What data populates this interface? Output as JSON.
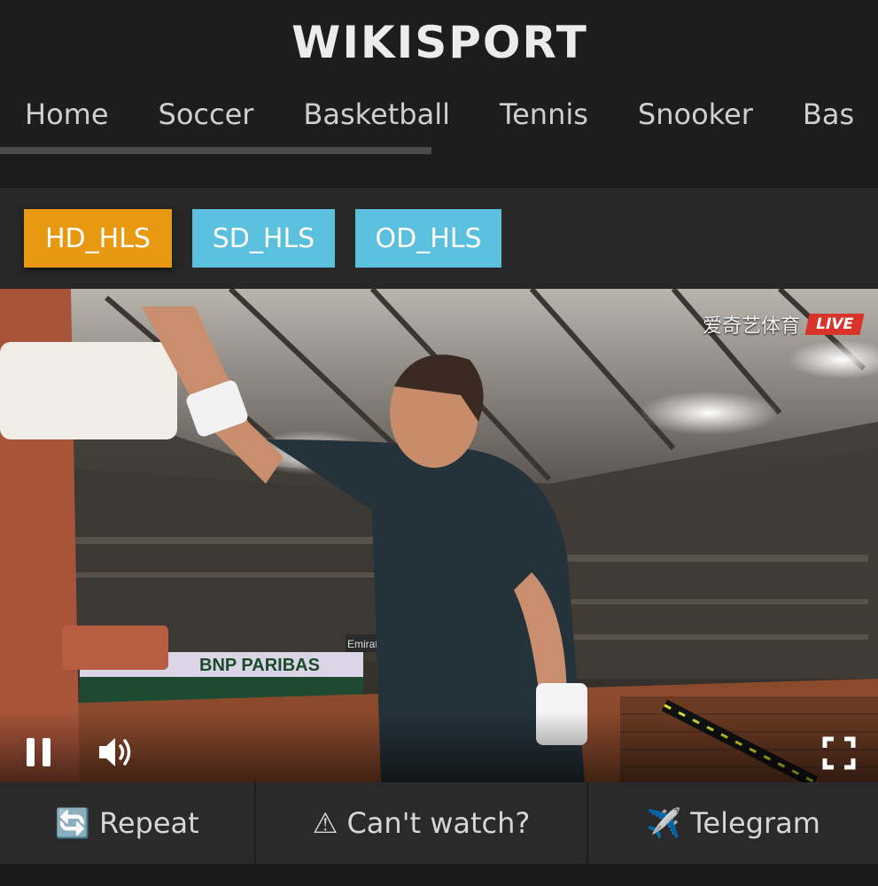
{
  "header": {
    "logo": "WIKISPORT"
  },
  "nav": {
    "items": [
      {
        "label": "Home"
      },
      {
        "label": "Soccer"
      },
      {
        "label": "Basketball"
      },
      {
        "label": "Tennis"
      },
      {
        "label": "Snooker"
      },
      {
        "label": "Bas"
      }
    ]
  },
  "sources": [
    {
      "label": "HD_HLS",
      "active": true,
      "color": "#e8990f"
    },
    {
      "label": "SD_HLS",
      "active": false,
      "color": "#5ac0de"
    },
    {
      "label": "OD_HLS",
      "active": false,
      "color": "#5ac0de"
    }
  ],
  "video": {
    "watermark": "爱奇艺体育",
    "live_label": "LIVE",
    "banner_text": "BNP PARIBAS",
    "sign_text": "Emirates"
  },
  "footer": {
    "repeat": {
      "icon": "🔄",
      "label": "Repeat"
    },
    "cant_watch": {
      "icon": "⚠",
      "label": "Can't watch?"
    },
    "telegram": {
      "icon": "✈️",
      "label": "Telegram"
    }
  }
}
